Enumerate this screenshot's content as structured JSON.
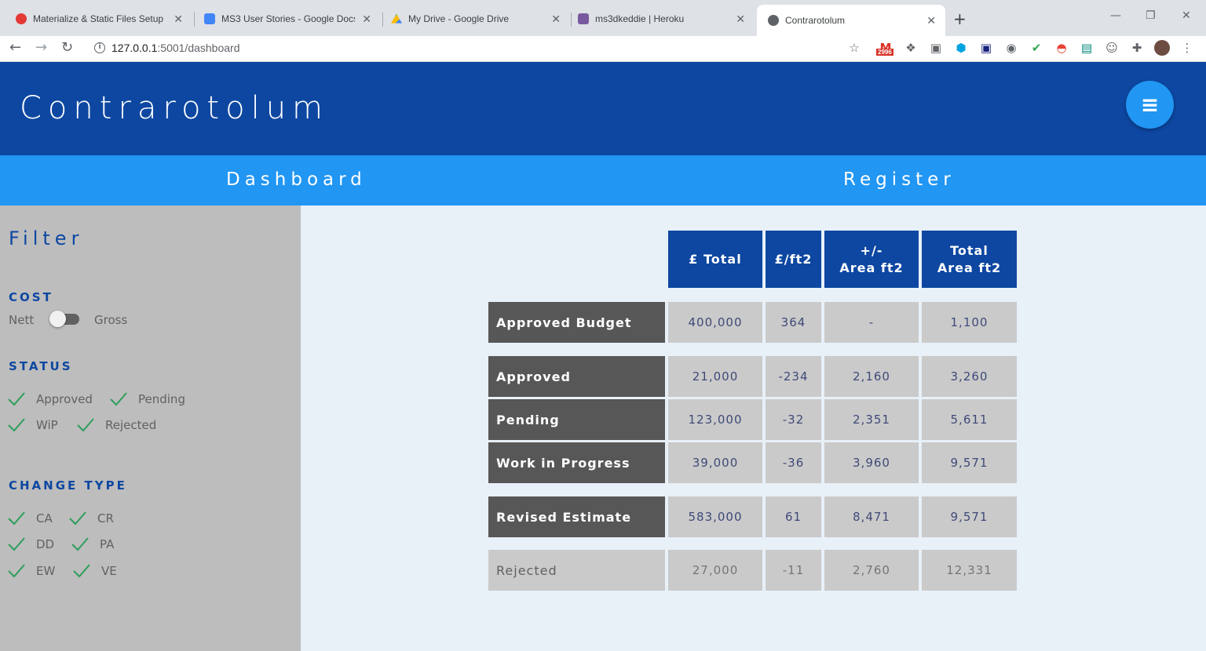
{
  "browser": {
    "tabs": [
      {
        "title": "Materialize & Static Files Setup |",
        "icon": "opera-icon",
        "color": "#e53935"
      },
      {
        "title": "MS3 User Stories - Google Docs",
        "icon": "docs-icon",
        "color": "#4285f4"
      },
      {
        "title": "My Drive - Google Drive",
        "icon": "drive-icon",
        "color": "#fbbc04"
      },
      {
        "title": "ms3dkeddie | Heroku",
        "icon": "heroku-icon",
        "color": "#79589f"
      },
      {
        "title": "Contrarotolum",
        "icon": "globe-icon",
        "color": "#5f6368"
      }
    ],
    "url_host": "127.0.0.1",
    "url_path": ":5001/dashboard",
    "mail_badge": "2996"
  },
  "app": {
    "brand": "Contrarotolum",
    "nav": {
      "dashboard": "Dashboard",
      "register": "Register"
    },
    "colors": {
      "primary": "#0d47a1",
      "accent": "#2196f3",
      "check": "#2e9e5b"
    }
  },
  "filter": {
    "title": "Filter",
    "cost": {
      "heading": "COST",
      "left": "Nett",
      "right": "Gross",
      "checked": false
    },
    "status": {
      "heading": "STATUS",
      "items": [
        "Approved",
        "Pending",
        "WiP",
        "Rejected"
      ]
    },
    "change_type": {
      "heading": "CHANGE TYPE",
      "items": [
        "CA",
        "CR",
        "DD",
        "PA",
        "EW",
        "VE"
      ]
    }
  },
  "table": {
    "headers": [
      "£ Total",
      "£/ft2",
      "+/-\nArea ft2",
      "Total\nArea ft2"
    ],
    "rows": [
      {
        "label": "Approved Budget",
        "values": [
          "400,000",
          "364",
          "-",
          "1,100"
        ]
      },
      {
        "label": "Approved",
        "values": [
          "21,000",
          "-234",
          "2,160",
          "3,260"
        ]
      },
      {
        "label": "Pending",
        "values": [
          "123,000",
          "-32",
          "2,351",
          "5,611"
        ]
      },
      {
        "label": "Work in Progress",
        "values": [
          "39,000",
          "-36",
          "3,960",
          "9,571"
        ]
      },
      {
        "label": "Revised Estimate",
        "values": [
          "583,000",
          "61",
          "8,471",
          "9,571"
        ]
      },
      {
        "label": "Rejected",
        "values": [
          "27,000",
          "-11",
          "2,760",
          "12,331"
        ]
      }
    ]
  }
}
